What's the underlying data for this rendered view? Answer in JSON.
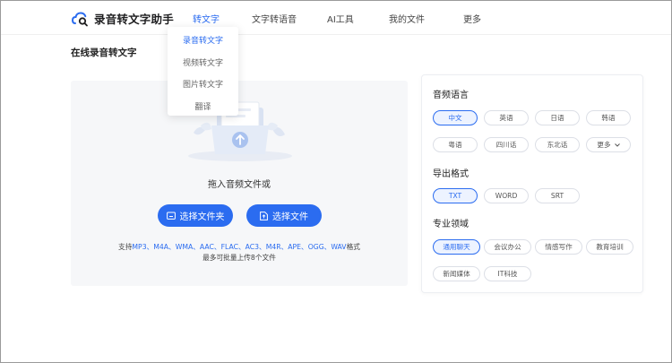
{
  "header": {
    "app_title": "录音转文字助手",
    "nav": [
      {
        "label": "转文字",
        "active": true
      },
      {
        "label": "文字转语音",
        "active": false
      },
      {
        "label": "AI工具",
        "active": false
      },
      {
        "label": "我的文件",
        "active": false
      },
      {
        "label": "更多",
        "active": false
      }
    ]
  },
  "dropdown": {
    "items": [
      {
        "label": "录音转文字",
        "active": true
      },
      {
        "label": "视频转文字",
        "active": false
      },
      {
        "label": "图片转文字",
        "active": false
      },
      {
        "label": "翻译",
        "active": false
      }
    ]
  },
  "main": {
    "title": "在线录音转文字",
    "upload": {
      "hint": "拖入音频文件或",
      "select_folder_label": "选择文件夹",
      "select_file_label": "选择文件",
      "formats_prefix": "支持",
      "formats": "MP3、M4A、WMA、AAC、FLAC、AC3、M4R、APE、OGG、WAV",
      "formats_suffix": "格式",
      "limit_text": "最多可批量上传8个文件"
    }
  },
  "settings": {
    "language": {
      "title": "音频语言",
      "options": [
        {
          "label": "中文",
          "active": true
        },
        {
          "label": "英语",
          "active": false
        },
        {
          "label": "日语",
          "active": false
        },
        {
          "label": "韩语",
          "active": false
        },
        {
          "label": "粤语",
          "active": false
        },
        {
          "label": "四川话",
          "active": false
        },
        {
          "label": "东北话",
          "active": false
        },
        {
          "label": "更多",
          "active": false
        }
      ]
    },
    "export": {
      "title": "导出格式",
      "options": [
        {
          "label": "TXT",
          "active": true
        },
        {
          "label": "WORD",
          "active": false
        },
        {
          "label": "SRT",
          "active": false
        }
      ]
    },
    "domain": {
      "title": "专业领域",
      "options": [
        {
          "label": "通用聊天",
          "active": true
        },
        {
          "label": "会议办公",
          "active": false
        },
        {
          "label": "情感写作",
          "active": false
        },
        {
          "label": "教育培训",
          "active": false
        },
        {
          "label": "新闻媒体",
          "active": false
        },
        {
          "label": "IT科技",
          "active": false
        }
      ]
    }
  },
  "colors": {
    "accent": "#2b6cf0",
    "panel_bg": "#f6f7f9",
    "active_chip_bg": "#edf3ff"
  },
  "icons": {
    "logo": "cloud-search-icon",
    "folder": "folder-icon",
    "file": "file-upload-icon",
    "chevron": "chevron-down-icon",
    "illustration": "folder-upload-illustration"
  }
}
